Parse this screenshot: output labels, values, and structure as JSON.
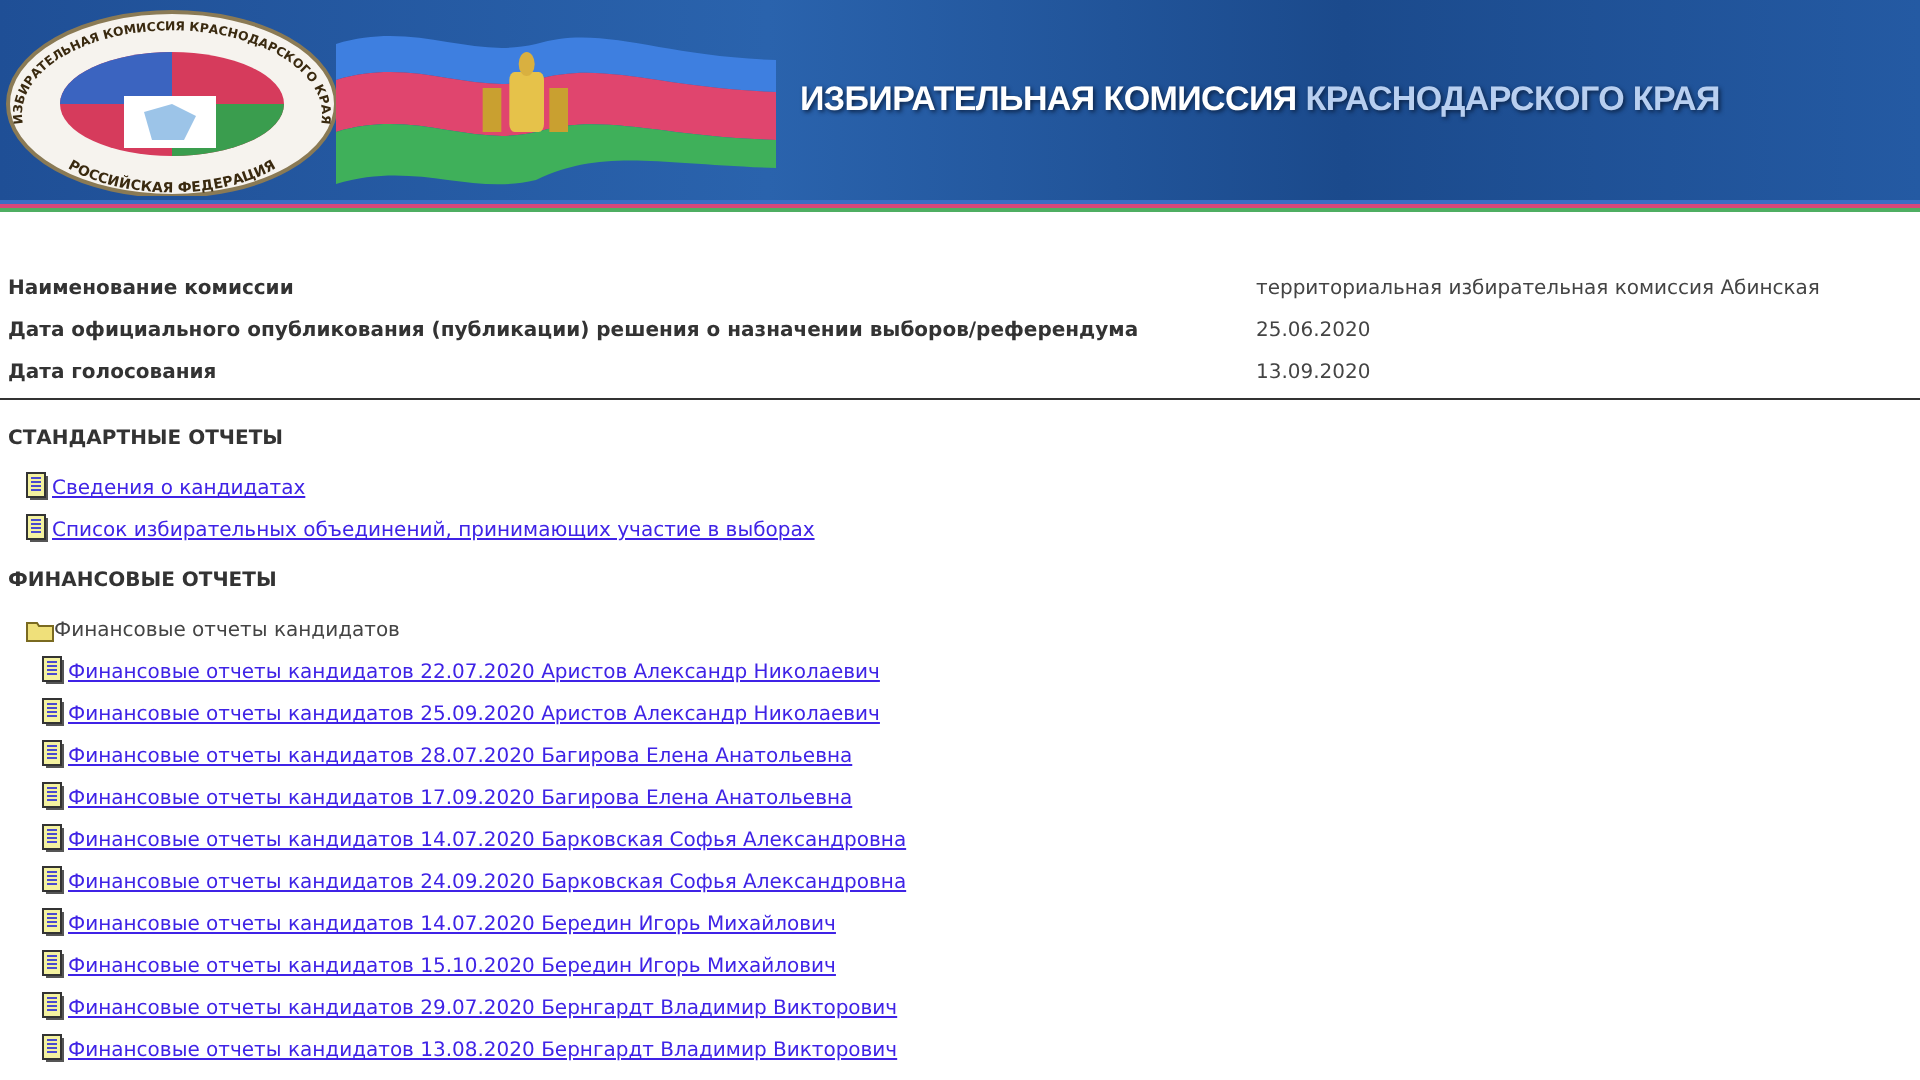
{
  "banner": {
    "logo": {
      "ring_top": "ИЗБИРАТЕЛЬНАЯ КОМИССИЯ КРАСНОДАРСКОГО КРАЯ",
      "ring_bottom": "РОССИЙСКАЯ ФЕДЕРАЦИЯ"
    },
    "title_main": "ИЗБИРАТЕЛЬНАЯ КОМИССИЯ",
    "title_region": "КРАСНОДАРСКОГО КРАЯ"
  },
  "info": [
    {
      "label": "Наименование комиссии",
      "value": "территориальная избирательная комиссия Абинская"
    },
    {
      "label": "Дата официального опубликования (публикации) решения о назначении выборов/референдума",
      "value": "25.06.2020"
    },
    {
      "label": "Дата голосования",
      "value": "13.09.2020"
    }
  ],
  "sections": [
    {
      "title": "СТАНДАРТНЫЕ ОТЧЕТЫ",
      "items": [
        {
          "kind": "document",
          "label": "Сведения о кандидатах"
        },
        {
          "kind": "document",
          "label": "Список избирательных объединений, принимающих участие в выборах"
        }
      ]
    },
    {
      "title": "ФИНАНСОВЫЕ ОТЧЕТЫ",
      "items": [
        {
          "kind": "folder",
          "label": "Финансовые отчеты кандидатов",
          "children": [
            {
              "kind": "document",
              "label": "Финансовые отчеты кандидатов 22.07.2020 Аристов Александр Николаевич"
            },
            {
              "kind": "document",
              "label": "Финансовые отчеты кандидатов 25.09.2020 Аристов Александр Николаевич"
            },
            {
              "kind": "document",
              "label": "Финансовые отчеты кандидатов 28.07.2020 Багирова Елена Анатольевна"
            },
            {
              "kind": "document",
              "label": "Финансовые отчеты кандидатов 17.09.2020 Багирова Елена Анатольевна"
            },
            {
              "kind": "document",
              "label": "Финансовые отчеты кандидатов 14.07.2020 Барковская Софья Александровна"
            },
            {
              "kind": "document",
              "label": "Финансовые отчеты кандидатов 24.09.2020 Барковская Софья Александровна"
            },
            {
              "kind": "document",
              "label": "Финансовые отчеты кандидатов 14.07.2020 Бередин Игорь Михайлович"
            },
            {
              "kind": "document",
              "label": "Финансовые отчеты кандидатов 15.10.2020 Бередин Игорь Михайлович"
            },
            {
              "kind": "document",
              "label": "Финансовые отчеты кандидатов 29.07.2020 Бернгардт Владимир Викторович"
            },
            {
              "kind": "document",
              "label": "Финансовые отчеты кандидатов 13.08.2020 Бернгардт Владимир Викторович"
            }
          ]
        }
      ]
    }
  ]
}
